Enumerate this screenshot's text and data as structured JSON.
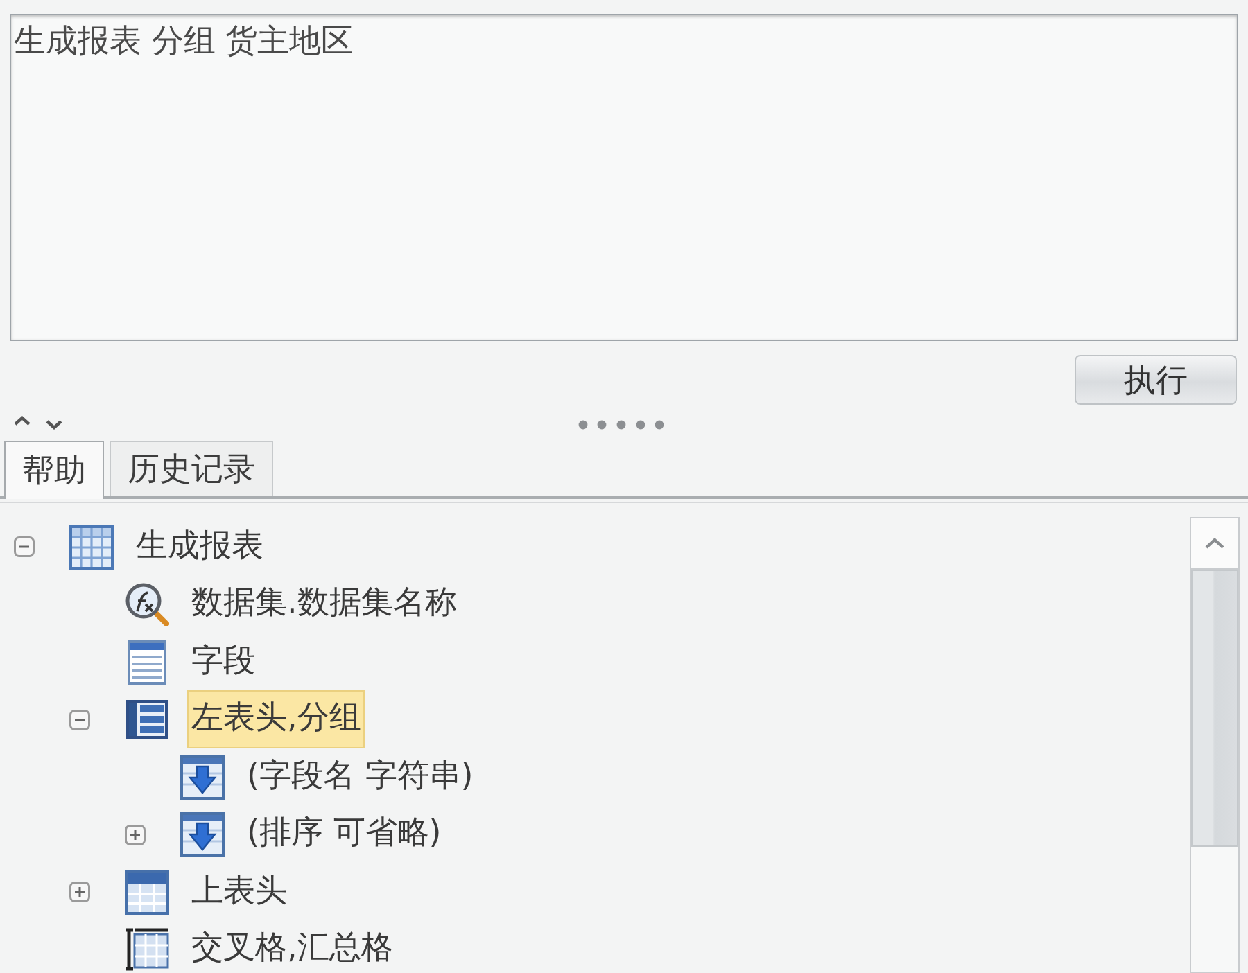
{
  "query_box": {
    "value": "生成报表 分组 货主地区"
  },
  "run_button": {
    "label": "执行"
  },
  "tabs": [
    {
      "label": "帮助",
      "selected": true
    },
    {
      "label": "历史记录",
      "selected": false
    }
  ],
  "help_tree": {
    "nodes": [
      {
        "label": "生成报表",
        "kind": "report",
        "expanded": true,
        "selected": false,
        "children": [
          {
            "label": "数据集.数据集名称",
            "kind": "dataset",
            "selected": false
          },
          {
            "label": "字段",
            "kind": "fields",
            "selected": false
          },
          {
            "label": "左表头,分组",
            "kind": "left-header",
            "expanded": true,
            "selected": true,
            "children": [
              {
                "label": "(字段名 字符串)",
                "kind": "parameter",
                "selected": false
              },
              {
                "label": "(排序 可省略)",
                "kind": "parameter",
                "expanded": false,
                "selected": false
              }
            ]
          },
          {
            "label": "上表头",
            "kind": "top-header",
            "expanded": false,
            "selected": false
          },
          {
            "label": "交叉格,汇总格",
            "kind": "cross-cell",
            "selected": false
          }
        ]
      }
    ]
  }
}
